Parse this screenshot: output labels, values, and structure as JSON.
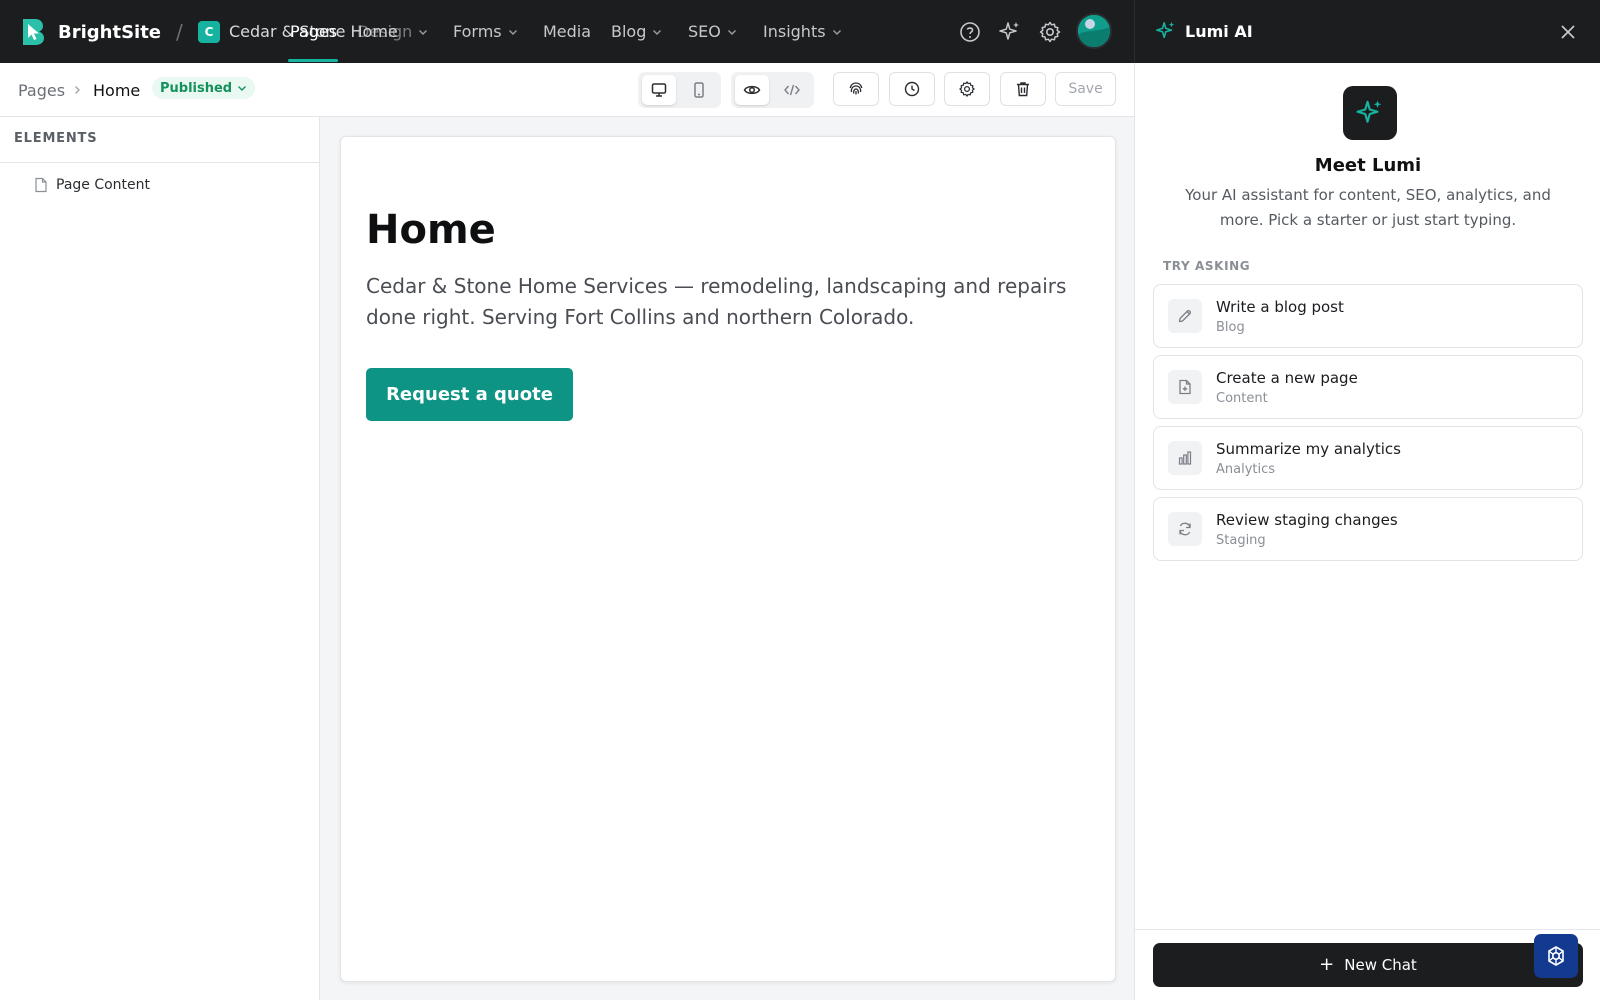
{
  "app": {
    "brand": "BrightSite"
  },
  "site": {
    "badge_letter": "C",
    "name": "Cedar & Stone Home"
  },
  "nav": {
    "pages": "Pages",
    "design": "Design",
    "forms": "Forms",
    "media": "Media",
    "blog": "Blog",
    "seo": "SEO",
    "insights": "Insights"
  },
  "breadcrumb": {
    "root": "Pages",
    "current": "Home"
  },
  "status": {
    "label": "Published",
    "color": "#15915e"
  },
  "toolbar": {
    "save_label": "Save"
  },
  "elements_panel": {
    "title": "ELEMENTS",
    "items": [
      {
        "label": "Page Content",
        "icon": "document-icon"
      }
    ]
  },
  "page": {
    "heading": "Home",
    "lead": "Cedar & Stone Home Services — remodeling, landscaping and repairs done right. Serving Fort Collins and northern Colorado.",
    "cta": "Request a quote",
    "cta_color": "#0e9484"
  },
  "ai": {
    "title": "Lumi AI",
    "meet": "Meet Lumi",
    "description": "Your AI assistant for content, SEO, analytics, and more. Pick a starter or just start typing.",
    "try_label": "TRY ASKING",
    "starters": [
      {
        "title": "Write a blog post",
        "sub": "Blog",
        "icon": "pencil-icon"
      },
      {
        "title": "Create a new page",
        "sub": "Content",
        "icon": "file-plus-icon"
      },
      {
        "title": "Summarize my analytics",
        "sub": "Analytics",
        "icon": "bar-chart-icon"
      },
      {
        "title": "Review staging changes",
        "sub": "Staging",
        "icon": "refresh-icon"
      }
    ],
    "new_chat": "New Chat",
    "accent": "#16b3a0"
  }
}
